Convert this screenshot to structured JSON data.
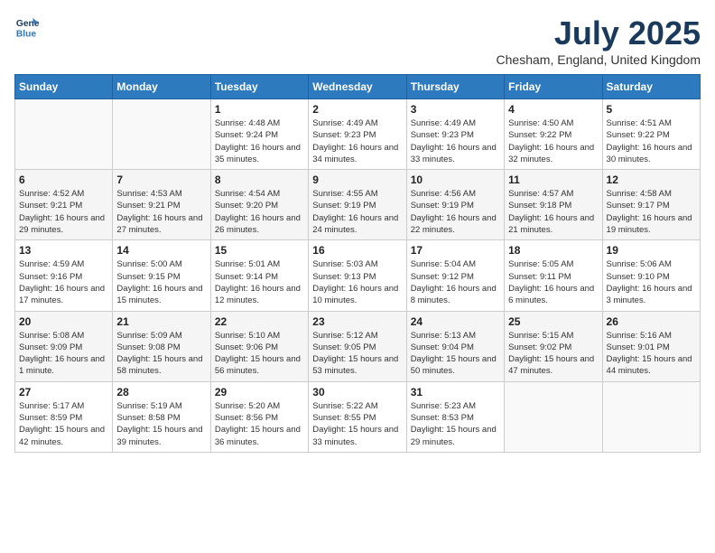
{
  "logo": {
    "line1": "General",
    "line2": "Blue"
  },
  "title": "July 2025",
  "location": "Chesham, England, United Kingdom",
  "weekdays": [
    "Sunday",
    "Monday",
    "Tuesday",
    "Wednesday",
    "Thursday",
    "Friday",
    "Saturday"
  ],
  "weeks": [
    [
      {
        "day": "",
        "info": ""
      },
      {
        "day": "",
        "info": ""
      },
      {
        "day": "1",
        "info": "Sunrise: 4:48 AM\nSunset: 9:24 PM\nDaylight: 16 hours and 35 minutes."
      },
      {
        "day": "2",
        "info": "Sunrise: 4:49 AM\nSunset: 9:23 PM\nDaylight: 16 hours and 34 minutes."
      },
      {
        "day": "3",
        "info": "Sunrise: 4:49 AM\nSunset: 9:23 PM\nDaylight: 16 hours and 33 minutes."
      },
      {
        "day": "4",
        "info": "Sunrise: 4:50 AM\nSunset: 9:22 PM\nDaylight: 16 hours and 32 minutes."
      },
      {
        "day": "5",
        "info": "Sunrise: 4:51 AM\nSunset: 9:22 PM\nDaylight: 16 hours and 30 minutes."
      }
    ],
    [
      {
        "day": "6",
        "info": "Sunrise: 4:52 AM\nSunset: 9:21 PM\nDaylight: 16 hours and 29 minutes."
      },
      {
        "day": "7",
        "info": "Sunrise: 4:53 AM\nSunset: 9:21 PM\nDaylight: 16 hours and 27 minutes."
      },
      {
        "day": "8",
        "info": "Sunrise: 4:54 AM\nSunset: 9:20 PM\nDaylight: 16 hours and 26 minutes."
      },
      {
        "day": "9",
        "info": "Sunrise: 4:55 AM\nSunset: 9:19 PM\nDaylight: 16 hours and 24 minutes."
      },
      {
        "day": "10",
        "info": "Sunrise: 4:56 AM\nSunset: 9:19 PM\nDaylight: 16 hours and 22 minutes."
      },
      {
        "day": "11",
        "info": "Sunrise: 4:57 AM\nSunset: 9:18 PM\nDaylight: 16 hours and 21 minutes."
      },
      {
        "day": "12",
        "info": "Sunrise: 4:58 AM\nSunset: 9:17 PM\nDaylight: 16 hours and 19 minutes."
      }
    ],
    [
      {
        "day": "13",
        "info": "Sunrise: 4:59 AM\nSunset: 9:16 PM\nDaylight: 16 hours and 17 minutes."
      },
      {
        "day": "14",
        "info": "Sunrise: 5:00 AM\nSunset: 9:15 PM\nDaylight: 16 hours and 15 minutes."
      },
      {
        "day": "15",
        "info": "Sunrise: 5:01 AM\nSunset: 9:14 PM\nDaylight: 16 hours and 12 minutes."
      },
      {
        "day": "16",
        "info": "Sunrise: 5:03 AM\nSunset: 9:13 PM\nDaylight: 16 hours and 10 minutes."
      },
      {
        "day": "17",
        "info": "Sunrise: 5:04 AM\nSunset: 9:12 PM\nDaylight: 16 hours and 8 minutes."
      },
      {
        "day": "18",
        "info": "Sunrise: 5:05 AM\nSunset: 9:11 PM\nDaylight: 16 hours and 6 minutes."
      },
      {
        "day": "19",
        "info": "Sunrise: 5:06 AM\nSunset: 9:10 PM\nDaylight: 16 hours and 3 minutes."
      }
    ],
    [
      {
        "day": "20",
        "info": "Sunrise: 5:08 AM\nSunset: 9:09 PM\nDaylight: 16 hours and 1 minute."
      },
      {
        "day": "21",
        "info": "Sunrise: 5:09 AM\nSunset: 9:08 PM\nDaylight: 15 hours and 58 minutes."
      },
      {
        "day": "22",
        "info": "Sunrise: 5:10 AM\nSunset: 9:06 PM\nDaylight: 15 hours and 56 minutes."
      },
      {
        "day": "23",
        "info": "Sunrise: 5:12 AM\nSunset: 9:05 PM\nDaylight: 15 hours and 53 minutes."
      },
      {
        "day": "24",
        "info": "Sunrise: 5:13 AM\nSunset: 9:04 PM\nDaylight: 15 hours and 50 minutes."
      },
      {
        "day": "25",
        "info": "Sunrise: 5:15 AM\nSunset: 9:02 PM\nDaylight: 15 hours and 47 minutes."
      },
      {
        "day": "26",
        "info": "Sunrise: 5:16 AM\nSunset: 9:01 PM\nDaylight: 15 hours and 44 minutes."
      }
    ],
    [
      {
        "day": "27",
        "info": "Sunrise: 5:17 AM\nSunset: 8:59 PM\nDaylight: 15 hours and 42 minutes."
      },
      {
        "day": "28",
        "info": "Sunrise: 5:19 AM\nSunset: 8:58 PM\nDaylight: 15 hours and 39 minutes."
      },
      {
        "day": "29",
        "info": "Sunrise: 5:20 AM\nSunset: 8:56 PM\nDaylight: 15 hours and 36 minutes."
      },
      {
        "day": "30",
        "info": "Sunrise: 5:22 AM\nSunset: 8:55 PM\nDaylight: 15 hours and 33 minutes."
      },
      {
        "day": "31",
        "info": "Sunrise: 5:23 AM\nSunset: 8:53 PM\nDaylight: 15 hours and 29 minutes."
      },
      {
        "day": "",
        "info": ""
      },
      {
        "day": "",
        "info": ""
      }
    ]
  ]
}
